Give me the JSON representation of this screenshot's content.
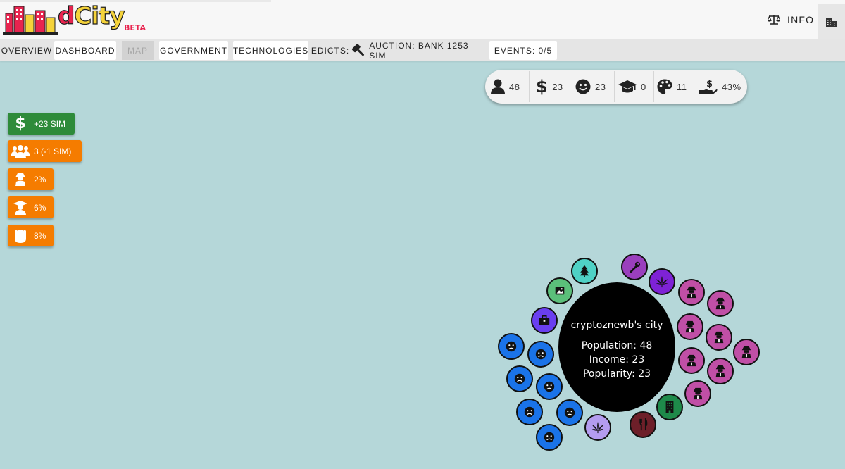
{
  "app": {
    "logo_text": "dCity",
    "beta_label": "BETA"
  },
  "header": {
    "info_label": "INFO"
  },
  "nav": {
    "overview": "OVERVIEW",
    "dashboard": "DASHBOARD",
    "map": "MAP",
    "government": "GOVERNMENT",
    "technologies": "TECHNOLOGIES",
    "edicts": "EDICTS:",
    "auction": "AUCTION: BANK 1253 SIM",
    "events": "EVENTS: 0/5"
  },
  "stats": {
    "population": "48",
    "income": "23",
    "happiness": "23",
    "education": "0",
    "culture": "11",
    "tax": "43%"
  },
  "badges": [
    {
      "icon": "dollar-icon",
      "label": "+23 SIM",
      "color": "#2e8b3a"
    },
    {
      "icon": "people-icon",
      "label": "3 (-1 SIM)",
      "color": "#f57c00"
    },
    {
      "icon": "criminal-icon",
      "label": "2%",
      "color": "#f57c00"
    },
    {
      "icon": "graduate-icon",
      "label": "6%",
      "color": "#f57c00"
    },
    {
      "icon": "fist-icon",
      "label": "8%",
      "color": "#f57c00"
    }
  ],
  "city": {
    "name": "cryptoznewb's city",
    "population": "Population: 48",
    "income": "Income: 23",
    "popularity": "Popularity: 23"
  },
  "colors": {
    "background": "#b5d7d9",
    "badge_green": "#2e8b3a",
    "badge_orange": "#f57c00",
    "sad_blue": "#1a73e8",
    "criminal_pink": "#c04fa6",
    "weed_purple": "#7e22d6",
    "wrench_purple": "#9a3fbd",
    "tree_teal": "#4fd1c5",
    "gallery_green": "#5bbf7a",
    "briefcase_violet": "#6a3ff0",
    "lavender": "#b49cf0",
    "restaurant_maroon": "#6d1f29",
    "office_green": "#1e8a4a"
  },
  "tokens": [
    {
      "kind": "sad-citizen",
      "icon": "sad-face-icon",
      "color": "#1a73e8"
    },
    {
      "kind": "criminal",
      "icon": "criminal-icon",
      "color": "#c04fa6"
    },
    {
      "kind": "weed-farm",
      "icon": "weed-icon",
      "color": "#7e22d6"
    },
    {
      "kind": "workshop",
      "icon": "wrench-icon",
      "color": "#9a3fbd"
    },
    {
      "kind": "park",
      "icon": "tree-icon",
      "color": "#4fd1c5"
    },
    {
      "kind": "gallery",
      "icon": "image-icon",
      "color": "#5bbf7a"
    },
    {
      "kind": "business",
      "icon": "briefcase-icon",
      "color": "#6a3ff0"
    },
    {
      "kind": "weed-shop",
      "icon": "weed-icon",
      "color": "#b49cf0"
    },
    {
      "kind": "restaurant",
      "icon": "fork-knife-icon",
      "color": "#6d1f29"
    },
    {
      "kind": "office",
      "icon": "building-icon",
      "color": "#1e8a4a"
    }
  ]
}
